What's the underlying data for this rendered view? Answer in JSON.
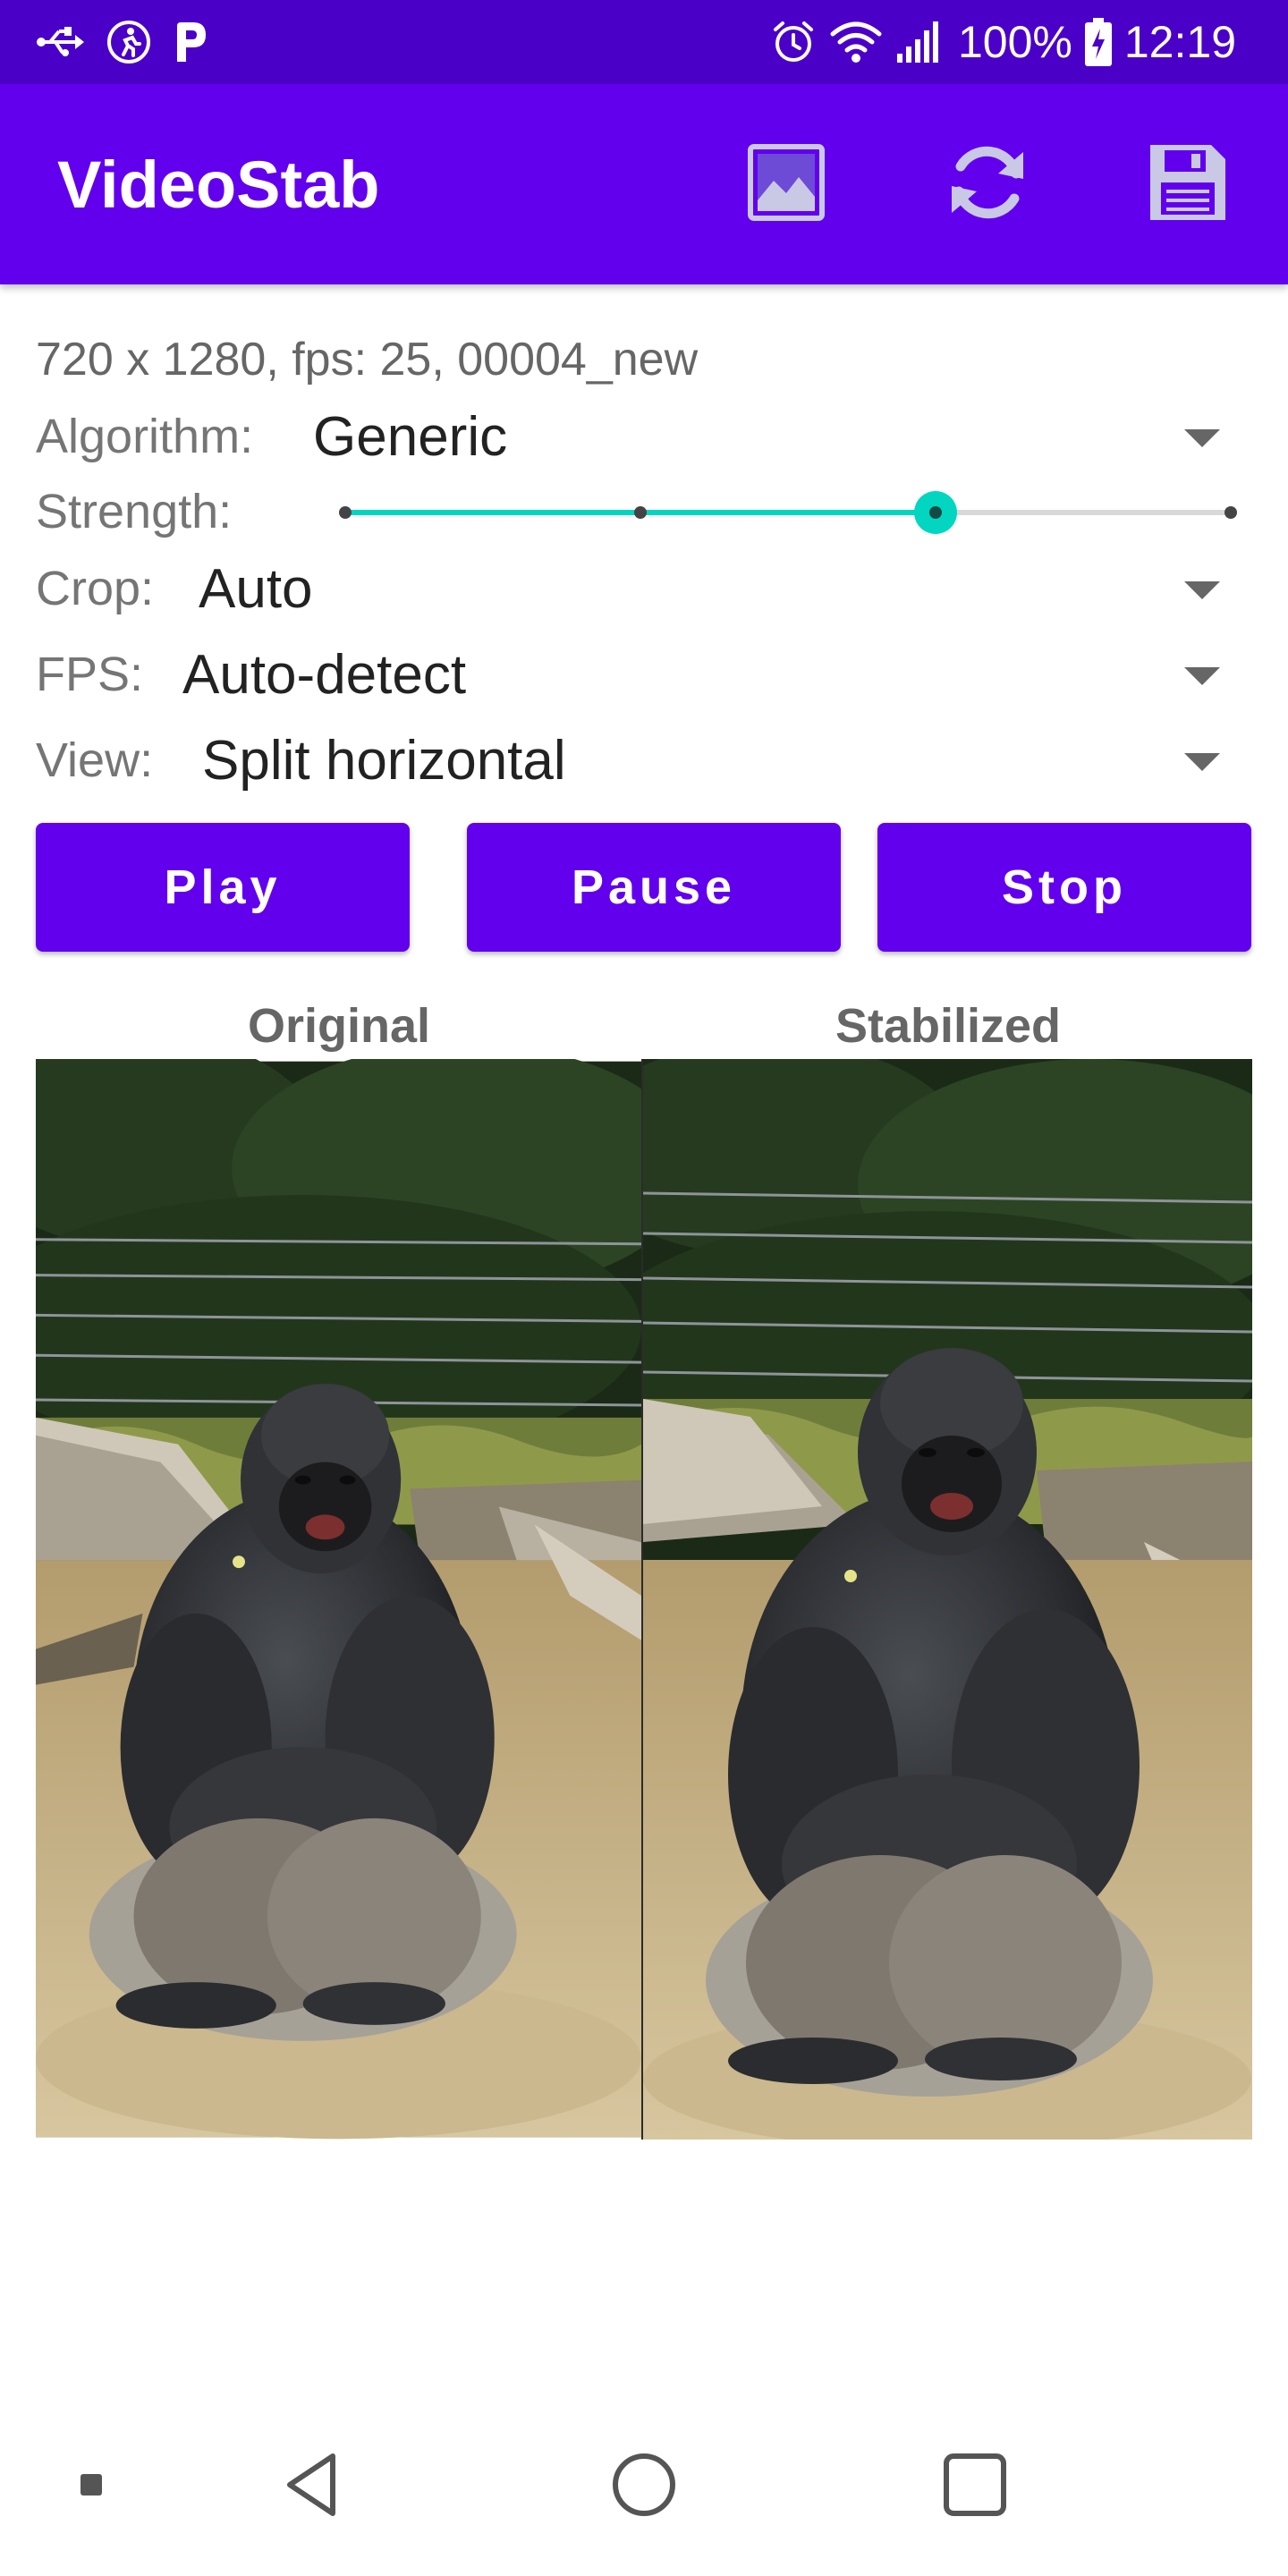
{
  "status_bar": {
    "battery": "100%",
    "time": "12:19",
    "icons": [
      "usb-icon",
      "accessibility-icon",
      "parking-app-icon",
      "alarm-icon",
      "wifi-icon",
      "signal-icon",
      "battery-charging-icon"
    ]
  },
  "app_bar": {
    "title": "VideoStab",
    "actions": [
      "gallery-icon",
      "refresh-icon",
      "save-icon"
    ]
  },
  "info": "720 x 1280, fps: 25, 00004_new",
  "controls": {
    "algorithm": {
      "label": "Algorithm:",
      "value": "Generic"
    },
    "strength": {
      "label": "Strength:",
      "level": 0.667,
      "ticks": 4
    },
    "crop": {
      "label": "Crop:",
      "value": "Auto"
    },
    "fps": {
      "label": "FPS:",
      "value": "Auto-detect"
    },
    "view": {
      "label": "View:",
      "value": "Split horizontal"
    }
  },
  "buttons": {
    "play": "Play",
    "pause": "Pause",
    "stop": "Stop"
  },
  "preview": {
    "original_label": "Original",
    "stabilized_label": "Stabilized"
  },
  "nav_bar": [
    "dot-icon",
    "back-icon",
    "home-icon",
    "recents-icon"
  ],
  "colors": {
    "status_bar": "#4b00c8",
    "primary": "#6200ee",
    "slider_accent": "#03d6c0"
  }
}
